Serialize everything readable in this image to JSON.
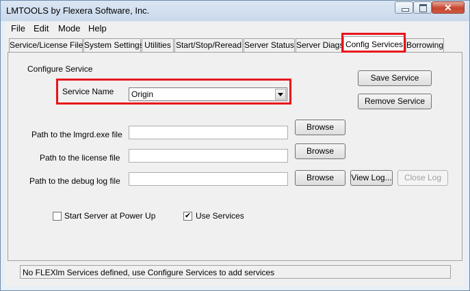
{
  "window": {
    "title": "LMTOOLS by Flexera Software, Inc."
  },
  "menu": [
    "File",
    "Edit",
    "Mode",
    "Help"
  ],
  "tabs": [
    "Service/License File",
    "System Settings",
    "Utilities",
    "Start/Stop/Reread",
    "Server Status",
    "Server Diags",
    "Config Services",
    "Borrowing"
  ],
  "active_tab": "Config Services",
  "config": {
    "group_label": "Configure Service",
    "service_name_label": "Service Name",
    "service_name_value": "Origin",
    "save_service": "Save Service",
    "remove_service": "Remove Service",
    "lmgrd_label": "Path to the lmgrd.exe file",
    "lmgrd_value": "",
    "license_label": "Path to the license file",
    "license_value": "",
    "debug_label": "Path to the debug log file",
    "debug_value": "",
    "browse": "Browse",
    "view_log": "View Log...",
    "close_log": "Close Log",
    "start_on_powerup_label": "Start Server at Power Up",
    "start_on_powerup_checked": false,
    "use_services_label": "Use Services",
    "use_services_checked": true
  },
  "status": "No FLEXlm Services defined, use Configure Services to add services"
}
